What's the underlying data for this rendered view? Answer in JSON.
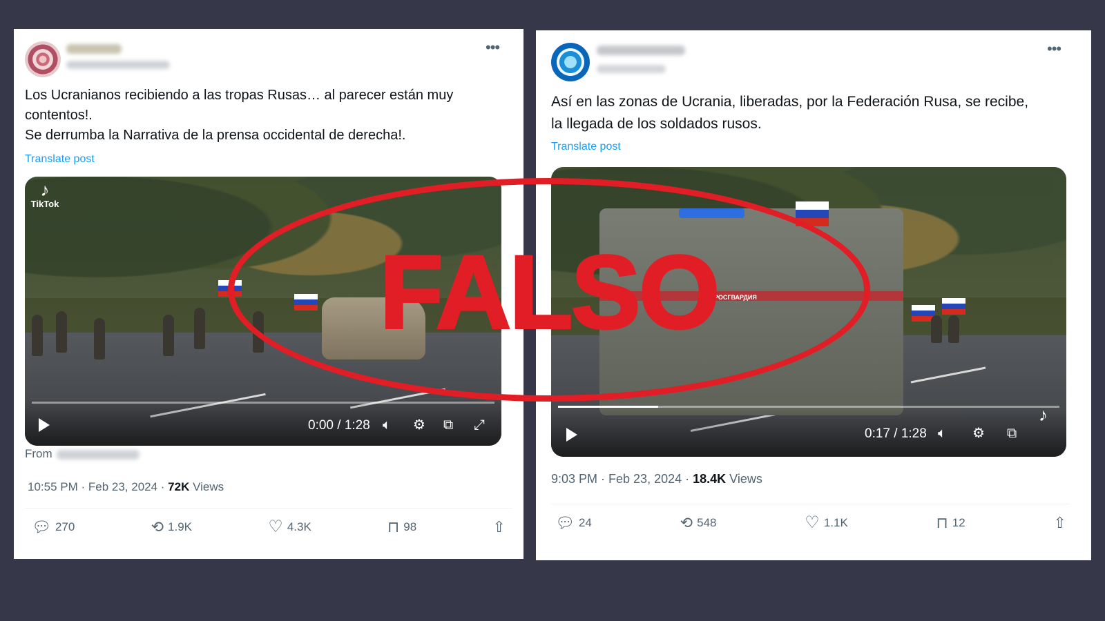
{
  "colors": {
    "background": "#363849",
    "card": "#ffffff",
    "link": "#1d9bf0",
    "muted": "#536471",
    "stamp": "#e11d25"
  },
  "stamp": {
    "text": "FALSO"
  },
  "left_post": {
    "text_lines": [
      "Los Ucranianos recibiendo a las tropas Rusas… al parecer están muy contentos!.",
      "Se derrumba la Narrativa de la prensa occidental de derecha!."
    ],
    "translate_label": "Translate post",
    "video": {
      "watermark": "TikTok",
      "time": "0:00 / 1:28",
      "progress": 0.0
    },
    "from_label": "From",
    "meta": {
      "time": "10:55 PM · Feb 23, 2024 · ",
      "views_count": "72K",
      "views_label": " Views"
    },
    "actions": {
      "replies": "270",
      "reposts": "1.9K",
      "likes": "4.3K",
      "bookmarks": "98"
    },
    "icons": [
      "more-icon",
      "tiktok-icon",
      "play-icon",
      "volume-icon",
      "settings-icon",
      "pip-icon",
      "fullscreen-icon",
      "reply-icon",
      "repost-icon",
      "like-icon",
      "bookmark-icon",
      "share-icon"
    ]
  },
  "right_post": {
    "text_lines": [
      "Así en las zonas de Ucrania, liberadas, por la Federación  Rusa, se recibe,",
      "la llegada de los soldados rusos."
    ],
    "translate_label": "Translate post",
    "video": {
      "time": "0:17 / 1:28",
      "progress": 0.2,
      "truck_label": "РОСГВАРДИЯ"
    },
    "meta": {
      "time": "9:03 PM · Feb 23, 2024 · ",
      "views_count": "18.4K",
      "views_label": " Views"
    },
    "actions": {
      "replies": "24",
      "reposts": "548",
      "likes": "1.1K",
      "bookmarks": "12"
    }
  }
}
